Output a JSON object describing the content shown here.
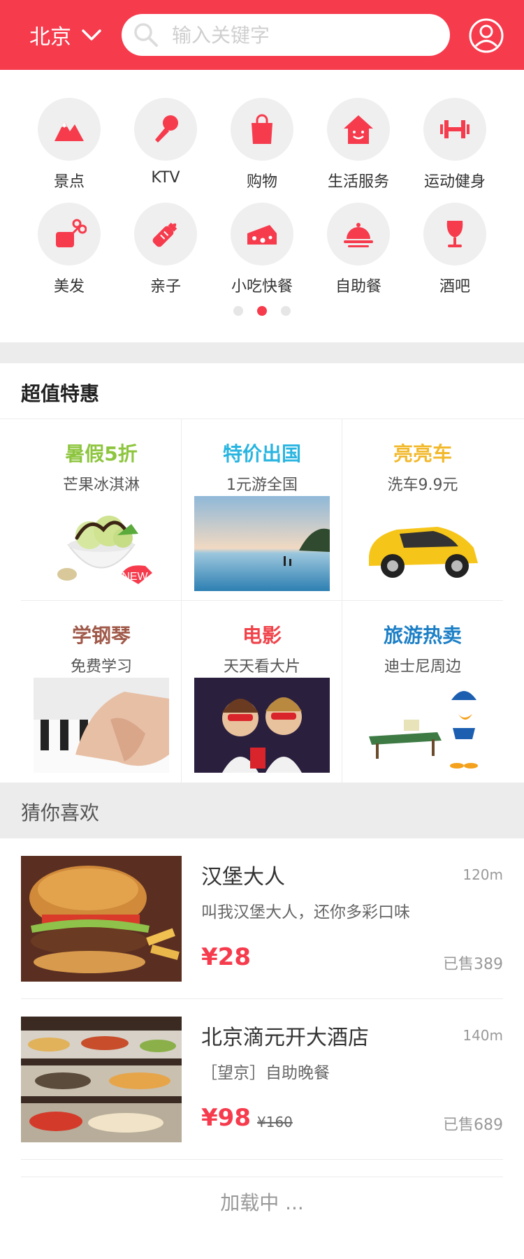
{
  "header": {
    "city": "北京",
    "search_placeholder": "输入关键字"
  },
  "categories": [
    {
      "label": "景点",
      "icon": "mountain-icon"
    },
    {
      "label": "KTV",
      "icon": "microphone-icon"
    },
    {
      "label": "购物",
      "icon": "shopping-bag-icon"
    },
    {
      "label": "生活服务",
      "icon": "house-icon"
    },
    {
      "label": "运动健身",
      "icon": "dumbbell-icon"
    },
    {
      "label": "美发",
      "icon": "scissors-icon"
    },
    {
      "label": "亲子",
      "icon": "baby-bottle-icon"
    },
    {
      "label": "小吃快餐",
      "icon": "cheese-icon"
    },
    {
      "label": "自助餐",
      "icon": "food-dome-icon"
    },
    {
      "label": "酒吧",
      "icon": "wine-glass-icon"
    }
  ],
  "carousel": {
    "pages": 3,
    "active": 1
  },
  "deals": {
    "title": "超值特惠",
    "items": [
      {
        "title": "暑假5折",
        "subtitle": "芒果冰淇淋",
        "color": "#8dc53e",
        "badge": "NEW"
      },
      {
        "title": "特价出国",
        "subtitle": "1元游全国",
        "color": "#2ab5e0"
      },
      {
        "title": "亮亮车",
        "subtitle": "洗车9.9元",
        "color": "#f2b92d"
      },
      {
        "title": "学钢琴",
        "subtitle": "免费学习",
        "color": "#a05a4a"
      },
      {
        "title": "电影",
        "subtitle": "天天看大片",
        "color": "#f0434a"
      },
      {
        "title": "旅游热卖",
        "subtitle": "迪士尼周边",
        "color": "#1c7fc6"
      }
    ]
  },
  "recommend": {
    "title": "猜你喜欢",
    "items": [
      {
        "name": "汉堡大人",
        "distance": "120m",
        "desc": "叫我汉堡大人，还你多彩口味",
        "price": "¥28",
        "original": "",
        "sold": "已售389"
      },
      {
        "name": "北京滴元开大酒店",
        "distance": "140m",
        "desc": "［望京］自助晚餐",
        "price": "¥98",
        "original": "¥160",
        "sold": "已售689"
      }
    ]
  },
  "loading": "加载中 ...",
  "colors": {
    "brand": "#f63b4d",
    "bg_gray": "#ececec"
  }
}
